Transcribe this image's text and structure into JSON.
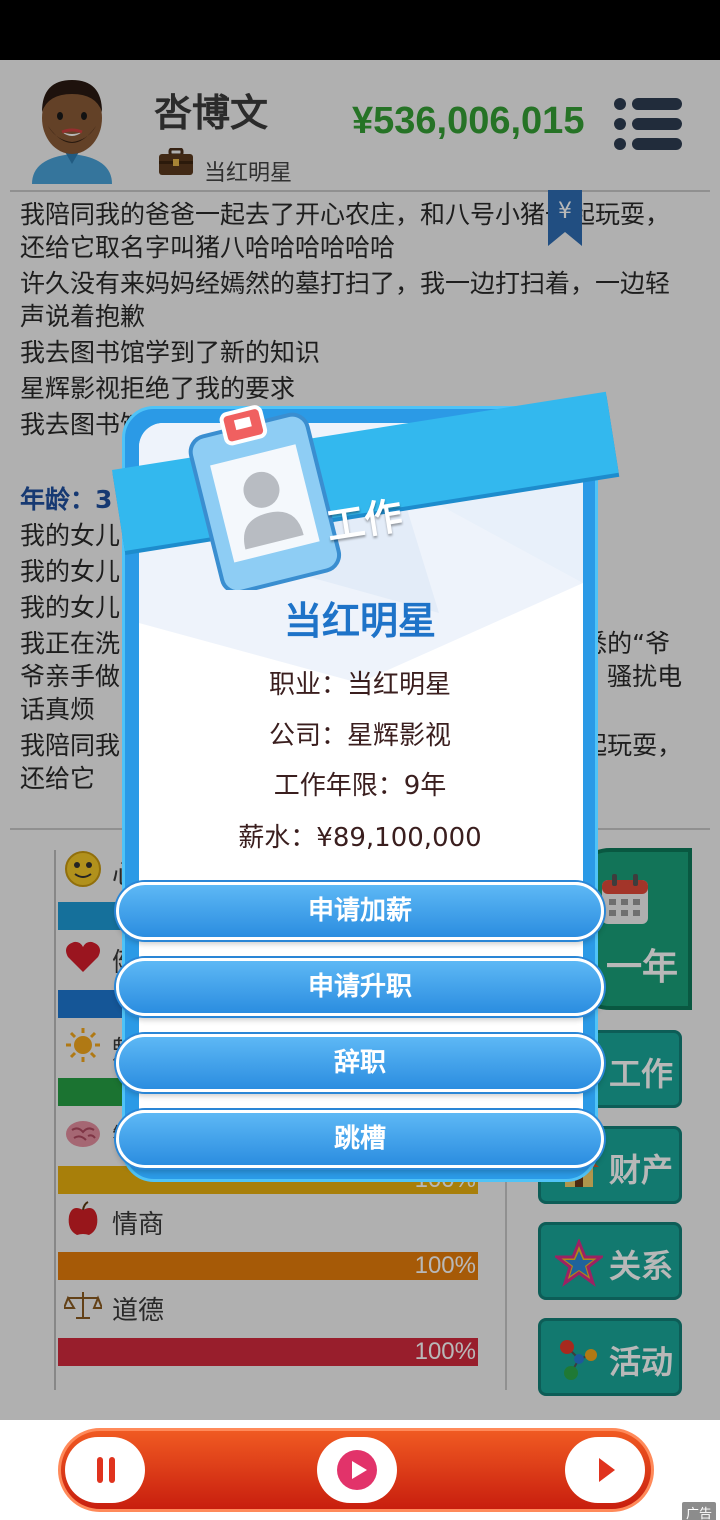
{
  "header": {
    "name": "呇博文",
    "job": "当红明星",
    "money": "¥536,006,015"
  },
  "log": {
    "lines_before": [
      "我陪同我的爸爸一起去了开心农庄，和八号小猪一起玩耍，还给它取名字叫猪八哈哈哈哈哈哈",
      "许久没有来妈妈经嫣然的墓打扫了，我一边打扫着，一边轻声说着抱歉",
      "我去图书馆学到了新的知识",
      "星辉影视拒绝了我的要求",
      "我去图书馆"
    ],
    "age_label": "年龄：3",
    "lines_after": [
      "我的女儿",
      "我的女儿",
      "我的女儿",
      "我正在洗                                                       熟悉的“爷爷亲手做                                                       听。骚扰电话真烦",
      "我陪同我                                                       一起玩耍，还给它"
    ]
  },
  "stats": [
    {
      "icon": "smiley-icon",
      "label": "心情",
      "pct": "",
      "color": "#1e9bd7"
    },
    {
      "icon": "heart-icon",
      "label": "健康",
      "pct": "",
      "color": "#1e78d2"
    },
    {
      "icon": "sun-icon",
      "label": "魅力",
      "pct": "",
      "color": "#26a045"
    },
    {
      "icon": "brain-icon",
      "label": "智商",
      "pct": "100%",
      "color": "#e9b10f"
    },
    {
      "icon": "apple-icon",
      "label": "情商",
      "pct": "100%",
      "color": "#e77d0b"
    },
    {
      "icon": "scales-icon",
      "label": "道德",
      "pct": "100%",
      "color": "#d32a3e"
    }
  ],
  "actions": {
    "year": "一年",
    "work": "工作",
    "assets": "财产",
    "relations": "关系",
    "activities": "活动"
  },
  "modal": {
    "ribbon": "工作",
    "title": "当红明星",
    "occupation": "职业：当红明星",
    "company": "公司：星辉影视",
    "years": "工作年限：9年",
    "salary": "薪水：¥89,100,000",
    "buttons": [
      "申请加薪",
      "申请升职",
      "辞职",
      "跳槽"
    ]
  },
  "ad": "广告"
}
